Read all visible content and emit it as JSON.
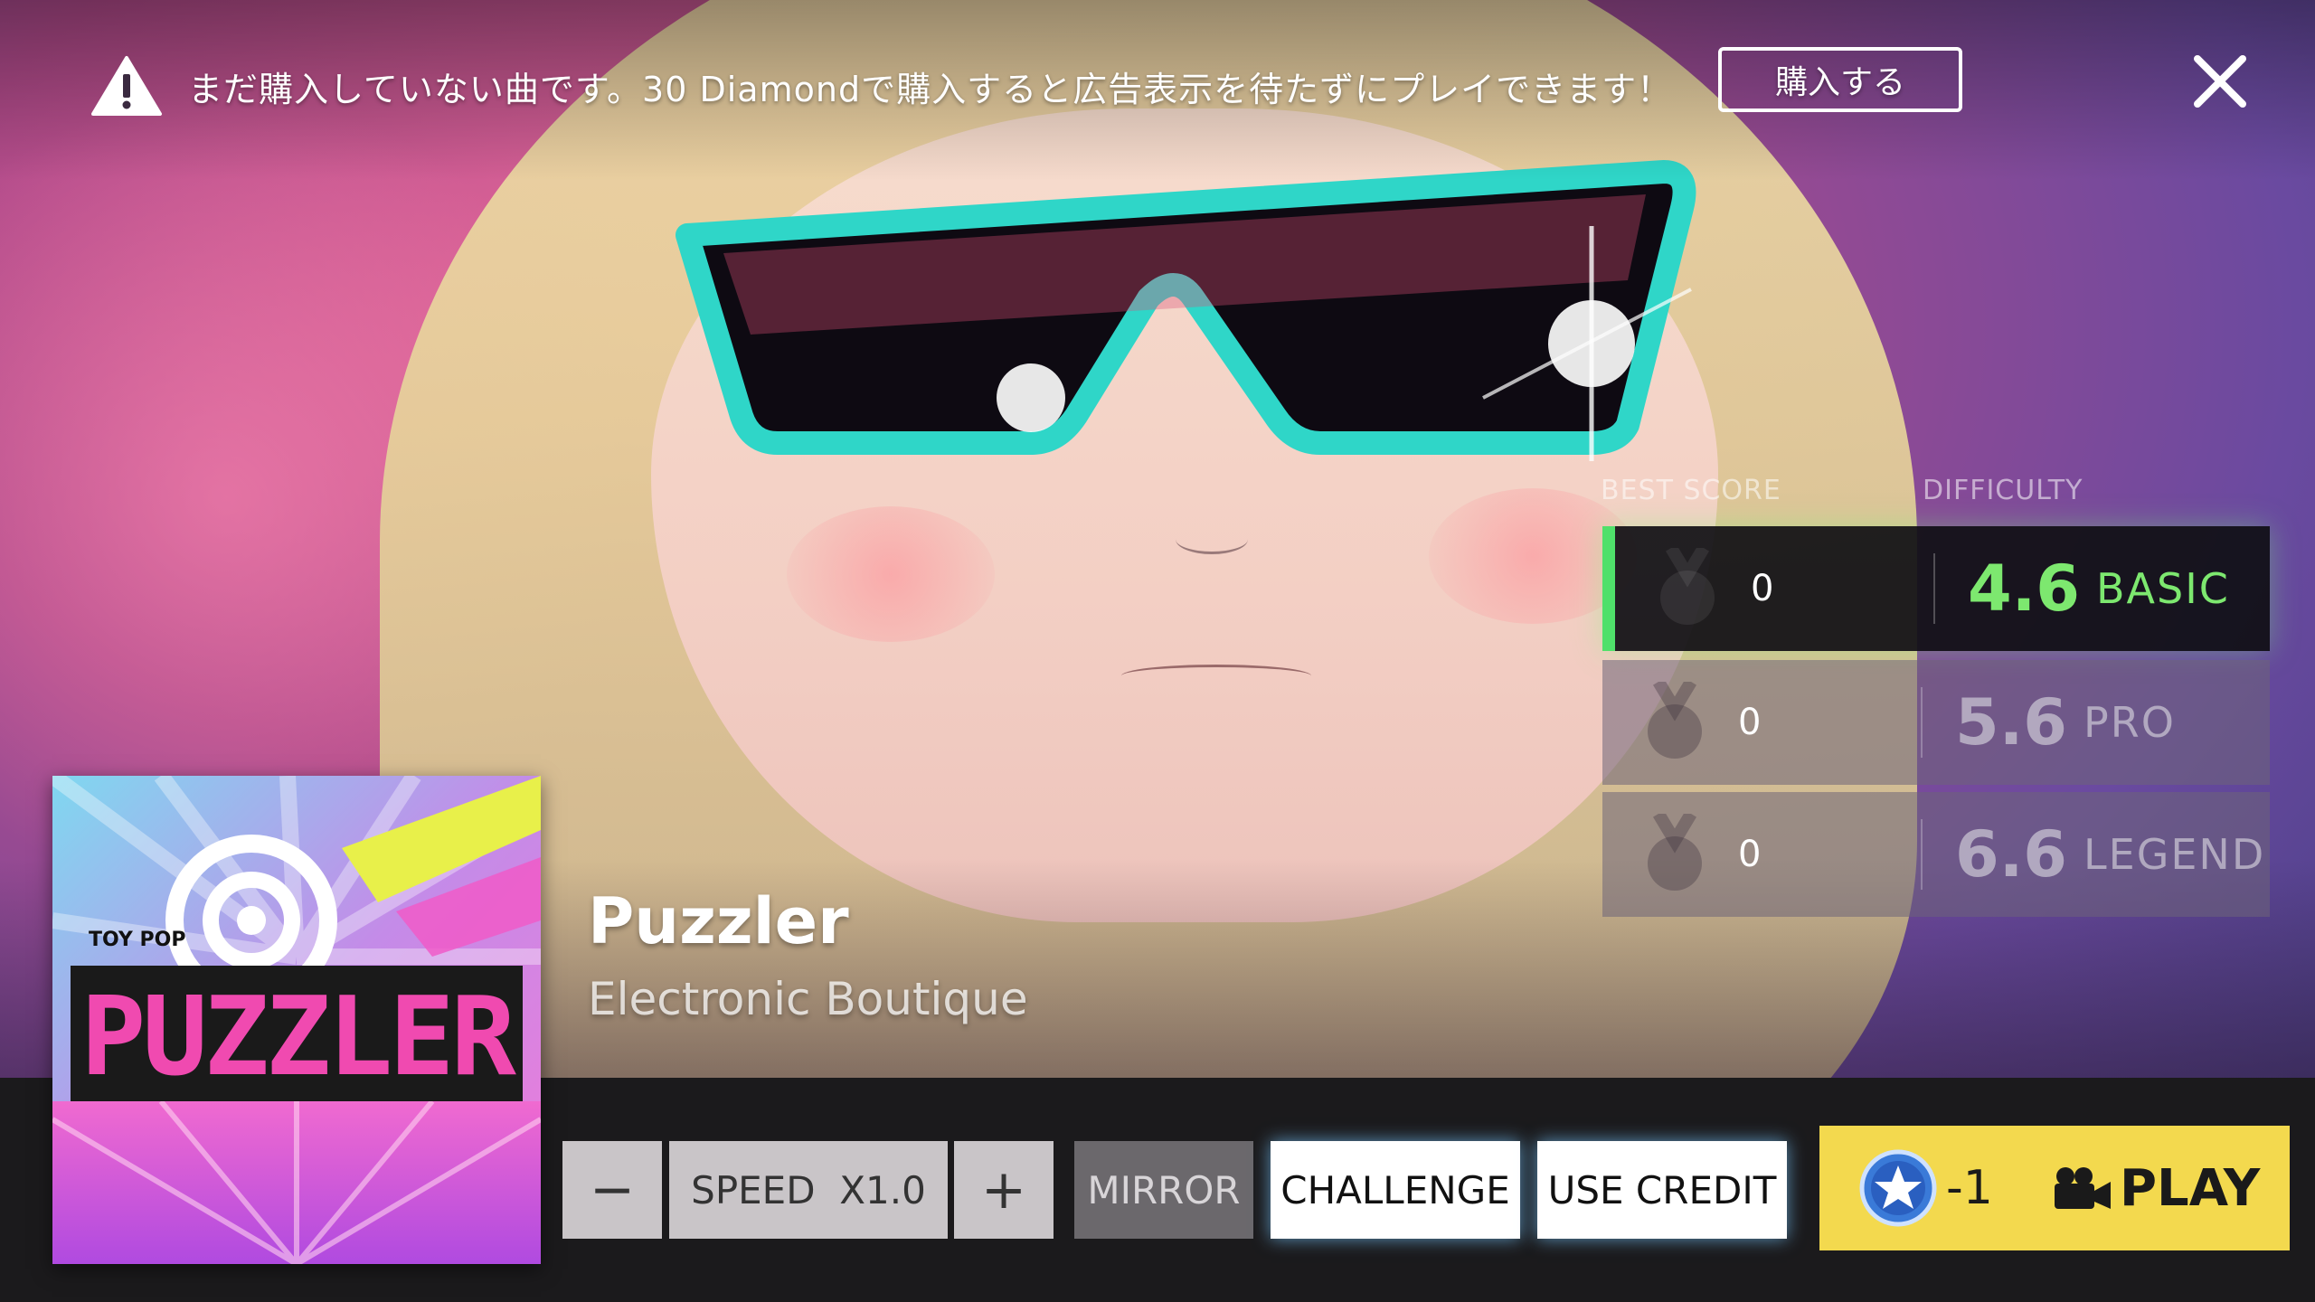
{
  "notice": {
    "text": "まだ購入していない曲です。30 Diamondで購入すると広告表示を待たずにプレイできます！",
    "buy_label": "購入する"
  },
  "panel": {
    "best_score_label": "BEST SCORE",
    "difficulty_label": "DIFFICULTY",
    "rows": [
      {
        "score": "0",
        "level": "4.6",
        "name": "BASIC"
      },
      {
        "score": "0",
        "level": "5.6",
        "name": "PRO"
      },
      {
        "score": "0",
        "level": "6.6",
        "name": "LEGEND"
      }
    ]
  },
  "song": {
    "title": "Puzzler",
    "artist": "Electronic Boutique",
    "album_art": {
      "small_text": "TOY POP",
      "big_text": "PUZZLER"
    }
  },
  "controls": {
    "minus": "−",
    "speed": "SPEED  X1.0",
    "plus": "+",
    "mirror": "MIRROR",
    "challenge": "CHALLENGE",
    "use_credit": "USE CREDIT",
    "play_cost": "-1",
    "play_label": "PLAY"
  },
  "colors": {
    "basic_accent": "#7de86f",
    "play_button": "#f3d94e"
  },
  "icons": {
    "warning": "warning-icon",
    "close": "close-icon",
    "medal": "medal-icon",
    "star_coin": "star-coin-icon",
    "camera": "video-camera-icon"
  }
}
